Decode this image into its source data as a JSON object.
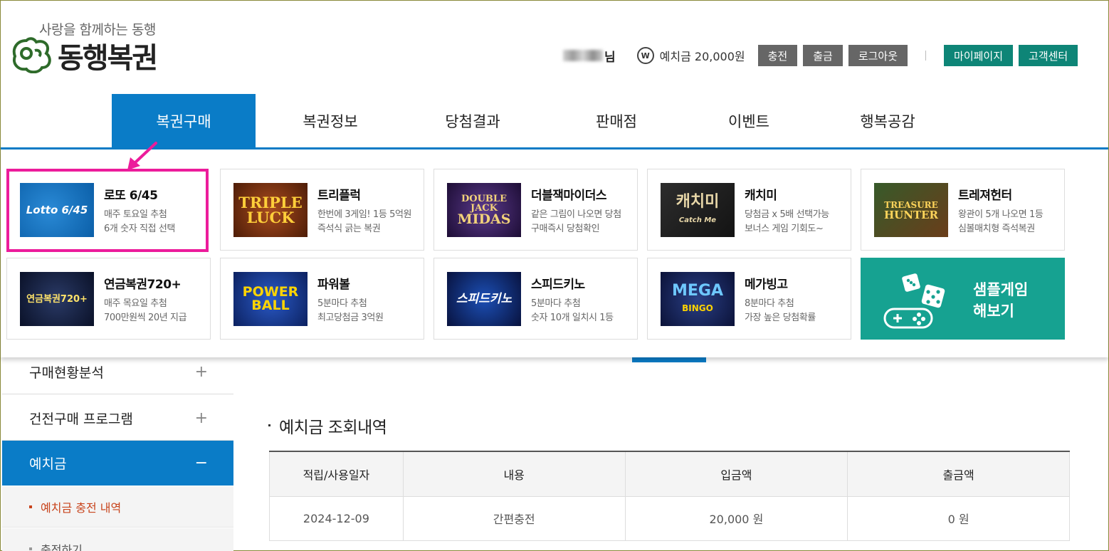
{
  "header": {
    "tagline": "사랑을 함께하는 동행",
    "brand": "동행복권",
    "user_suffix": "님",
    "won_symbol": "W",
    "deposit_text": "예치금 20,000원",
    "buttons": {
      "charge": "충전",
      "withdraw": "출금",
      "logout": "로그아웃",
      "mypage": "마이페이지",
      "support": "고객센터"
    }
  },
  "gnb": [
    {
      "label": "복권구매",
      "active": true
    },
    {
      "label": "복권정보"
    },
    {
      "label": "당첨결과"
    },
    {
      "label": "판매점"
    },
    {
      "label": "이벤트"
    },
    {
      "label": "행복공감"
    }
  ],
  "games": [
    {
      "title": "로또 6/45",
      "desc1": "매주 토요일 추첨",
      "desc2": "6개 숫자 직접 선택",
      "thumb": "Lotto 6/45"
    },
    {
      "title": "트리플럭",
      "desc1": "한번에 3게임! 1등 5억원",
      "desc2": "즉석식 긁는 복권",
      "thumb1": "TRIPLE",
      "thumb2": "LUCK"
    },
    {
      "title": "더블잭마이더스",
      "desc1": "같은 그림이 나오면 당첨",
      "desc2": "구매즉시 당첨확인",
      "thumb1": "DOUBLE JACK",
      "thumb2": "MIDAS"
    },
    {
      "title": "캐치미",
      "desc1": "당첨금 x 5배 선택가능",
      "desc2": "보너스 게임 기회도~",
      "thumb1": "캐치미",
      "thumb2": "Catch Me"
    },
    {
      "title": "트레져헌터",
      "desc1": "왕관이 5개 나오면 1등",
      "desc2": "심볼매치형 즉석복권",
      "thumb1": "TREASURE",
      "thumb2": "HUNTER"
    },
    {
      "title": "연금복권720+",
      "desc1": "매주 목요일 추첨",
      "desc2": "700만원씩 20년 지급",
      "thumb": "연금복권720+"
    },
    {
      "title": "파워볼",
      "desc1": "5분마다 추첨",
      "desc2": "최고당첨금 3억원",
      "thumb1": "POWER",
      "thumb2": "BALL"
    },
    {
      "title": "스피드키노",
      "desc1": "5분마다 추첨",
      "desc2": "숫자 10개 일치시 1등",
      "thumb": "스피드키노"
    },
    {
      "title": "메가빙고",
      "desc1": "8분마다 추첨",
      "desc2": "가장 높은 당첨확률",
      "thumb1": "MEGA",
      "thumb2": "BINGO"
    }
  ],
  "sample_game": {
    "line1": "샘플게임",
    "line2": "해보기"
  },
  "leftnav": {
    "items": [
      {
        "label": "구매현황분석",
        "sign": "+"
      },
      {
        "label": "건전구매 프로그램",
        "sign": "+"
      },
      {
        "label": "예치금",
        "sign": "−"
      }
    ],
    "subs": [
      "예치금 충전 내역",
      "충전하기"
    ]
  },
  "section": {
    "title": "예치금 조회내역"
  },
  "table": {
    "headers": [
      "적립/사용일자",
      "내용",
      "입금액",
      "출금액"
    ],
    "rows": [
      [
        "2024-12-09",
        "간편충전",
        "20,000 원",
        "0 원"
      ]
    ]
  },
  "colors": {
    "primary_blue": "#0a7cc7",
    "teal": "#0e8577",
    "sample_teal": "#16a291",
    "highlight_pink": "#ec1c9b",
    "active_sub": "#c8441c"
  }
}
